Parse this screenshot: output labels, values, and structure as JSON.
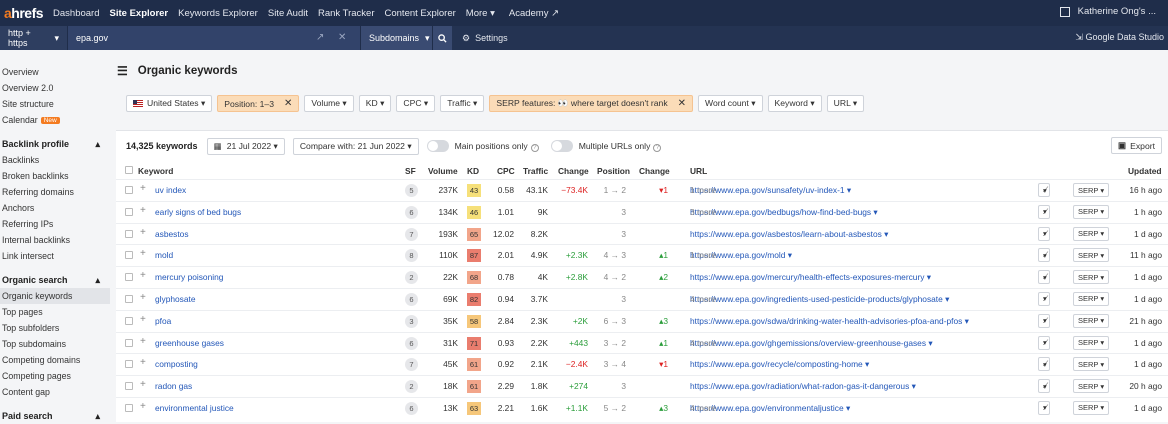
{
  "brand": {
    "a": "a",
    "rest": "hrefs"
  },
  "nav": {
    "items": [
      "Dashboard",
      "Site Explorer",
      "Keywords Explorer",
      "Site Audit",
      "Rank Tracker",
      "Content Explorer",
      "More ▾",
      "Academy ↗"
    ],
    "user": "Katherine Ong's ..."
  },
  "search": {
    "protocol": "http + https",
    "domain": "epa.gov",
    "mode": "Subdomains",
    "settings": "Settings",
    "gds": "Google Data Studio"
  },
  "sidebar": {
    "top": [
      "Overview",
      "Overview 2.0",
      "Site structure",
      "Calendar"
    ],
    "new_badge": "New",
    "backlink_title": "Backlink profile",
    "backlink": [
      "Backlinks",
      "Broken backlinks",
      "Referring domains",
      "Anchors",
      "Referring IPs",
      "Internal backlinks",
      "Link intersect"
    ],
    "organic_title": "Organic search",
    "organic": [
      "Organic keywords",
      "Top pages",
      "Top subfolders",
      "Top subdomains",
      "Competing domains",
      "Competing pages",
      "Content gap"
    ],
    "paid_title": "Paid search"
  },
  "page": {
    "title": "Organic keywords"
  },
  "filters": [
    "United States ▾",
    "Position: 1–3",
    "Volume ▾",
    "KD ▾",
    "CPC ▾",
    "Traffic ▾",
    "SERP features: 👀 where target doesn't rank",
    "Word count ▾",
    "Keyword ▾",
    "URL ▾"
  ],
  "toolbar": {
    "count": "14,325 keywords",
    "date": "21 Jul 2022 ▾",
    "compare": "Compare with: 21 Jun 2022 ▾",
    "main_only": "Main positions only",
    "multi_urls": "Multiple URLs only",
    "export": "Export"
  },
  "columns": {
    "keyword": "Keyword",
    "sf": "SF",
    "volume": "Volume",
    "kd": "KD",
    "cpc": "CPC",
    "traffic": "Traffic",
    "change": "Change",
    "position": "Position",
    "pchange": "Change",
    "url": "URL",
    "updated": "Updated"
  },
  "rows": [
    {
      "kw": "uv index",
      "sf": "5",
      "vol": "237K",
      "kd": "43",
      "kdc": "#f6e07a",
      "cpc": "0.58",
      "traf": "43.1K",
      "chg": "−73.4K",
      "chgc": "neg",
      "pos": "1 → 2",
      "pchg": "▾1",
      "pchgc": "neg",
      "url": "https://www.epa.gov/sunsafety/uv-index-1 ▾",
      "more": "1 more",
      "upd": "16 h ago"
    },
    {
      "kw": "early signs of bed bugs",
      "sf": "6",
      "vol": "134K",
      "kd": "46",
      "kdc": "#f6e07a",
      "cpc": "1.01",
      "traf": "9K",
      "chg": "",
      "chgc": "",
      "pos": "3",
      "pchg": "",
      "pchgc": "",
      "url": "https://www.epa.gov/bedbugs/how-find-bed-bugs ▾",
      "more": "3 more",
      "upd": "1 h ago"
    },
    {
      "kw": "asbestos",
      "sf": "7",
      "vol": "193K",
      "kd": "65",
      "kdc": "#f2a58a",
      "cpc": "12.02",
      "traf": "8.2K",
      "chg": "",
      "chgc": "",
      "pos": "3",
      "pchg": "",
      "pchgc": "",
      "url": "https://www.epa.gov/asbestos/learn-about-asbestos ▾",
      "more": "",
      "upd": "1 d ago"
    },
    {
      "kw": "mold",
      "sf": "8",
      "vol": "110K",
      "kd": "87",
      "kdc": "#ea7d6e",
      "cpc": "2.01",
      "traf": "4.9K",
      "chg": "+2.3K",
      "chgc": "pos",
      "pos": "4 → 3",
      "pchg": "▴1",
      "pchgc": "pos",
      "url": "https://www.epa.gov/mold ▾",
      "more": "1 more",
      "upd": "11 h ago"
    },
    {
      "kw": "mercury poisoning",
      "sf": "2",
      "vol": "22K",
      "kd": "68",
      "kdc": "#f2a58a",
      "cpc": "0.78",
      "traf": "4K",
      "chg": "+2.8K",
      "chgc": "pos",
      "pos": "4 → 2",
      "pchg": "▴2",
      "pchgc": "pos",
      "url": "https://www.epa.gov/mercury/health-effects-exposures-mercury ▾",
      "more": "",
      "upd": "1 d ago"
    },
    {
      "kw": "glyphosate",
      "sf": "6",
      "vol": "69K",
      "kd": "82",
      "kdc": "#ea7d6e",
      "cpc": "0.94",
      "traf": "3.7K",
      "chg": "",
      "chgc": "",
      "pos": "3",
      "pchg": "",
      "pchgc": "",
      "url": "https://www.epa.gov/ingredients-used-pesticide-products/glyphosate ▾",
      "more": "4 more",
      "upd": "1 d ago"
    },
    {
      "kw": "pfoa",
      "sf": "3",
      "vol": "35K",
      "kd": "58",
      "kdc": "#f6c77a",
      "cpc": "2.84",
      "traf": "2.3K",
      "chg": "+2K",
      "chgc": "pos",
      "pos": "6 → 3",
      "pchg": "▴3",
      "pchgc": "pos",
      "url": "https://www.epa.gov/sdwa/drinking-water-health-advisories-pfoa-and-pfos ▾",
      "more": "",
      "upd": "21 h ago"
    },
    {
      "kw": "greenhouse gases",
      "sf": "6",
      "vol": "31K",
      "kd": "71",
      "kdc": "#ea7d6e",
      "cpc": "0.93",
      "traf": "2.2K",
      "chg": "+443",
      "chgc": "pos",
      "pos": "3 → 2",
      "pchg": "▴1",
      "pchgc": "pos",
      "url": "https://www.epa.gov/ghgemissions/overview-greenhouse-gases ▾",
      "more": "4 more",
      "upd": "1 d ago"
    },
    {
      "kw": "composting",
      "sf": "7",
      "vol": "45K",
      "kd": "61",
      "kdc": "#f2a58a",
      "cpc": "0.92",
      "traf": "2.1K",
      "chg": "−2.4K",
      "chgc": "neg",
      "pos": "3 → 4",
      "pchg": "▾1",
      "pchgc": "neg",
      "url": "https://www.epa.gov/recycle/composting-home ▾",
      "more": "",
      "upd": "1 d ago"
    },
    {
      "kw": "radon gas",
      "sf": "2",
      "vol": "18K",
      "kd": "61",
      "kdc": "#f2a58a",
      "cpc": "2.29",
      "traf": "1.8K",
      "chg": "+274",
      "chgc": "pos",
      "pos": "3",
      "pchg": "",
      "pchgc": "",
      "url": "https://www.epa.gov/radiation/what-radon-gas-it-dangerous ▾",
      "more": "",
      "upd": "20 h ago"
    },
    {
      "kw": "environmental justice",
      "sf": "6",
      "vol": "13K",
      "kd": "63",
      "kdc": "#f6c77a",
      "cpc": "2.21",
      "traf": "1.6K",
      "chg": "+1.1K",
      "chgc": "pos",
      "pos": "5 → 2",
      "pchg": "▴3",
      "pchgc": "pos",
      "url": "https://www.epa.gov/environmentaljustice ▾",
      "more": "4 more",
      "upd": "1 d ago"
    }
  ],
  "row_controls": {
    "trend": "▾",
    "serp": "SERP ▾"
  }
}
